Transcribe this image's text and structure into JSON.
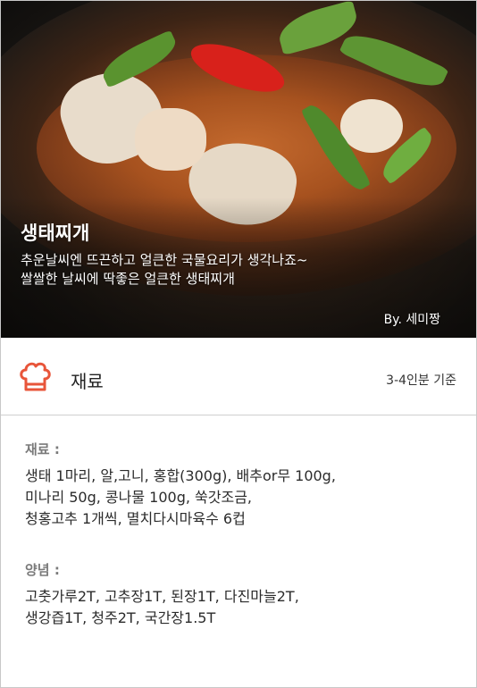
{
  "hero": {
    "title": "생태찌개",
    "subtitle_lines": [
      "추운날씨엔 뜨끈하고 얼큰한 국물요리가 생각나죠~",
      "쌀쌀한 날씨에 딱좋은 얼큰한 생태찌개"
    ],
    "byline": "By. 세미짱"
  },
  "ingredients_header": {
    "icon": "chef-hat-icon",
    "label": "재료",
    "serving": "3-4인분 기준",
    "accent_color": "#e8553a"
  },
  "sections": [
    {
      "title": "재료 :",
      "lines": [
        "생태 1마리, 알,고니, 홍합(300g), 배추or무 100g,",
        "미나리 50g, 콩나물 100g, 쑥갓조금,",
        "청홍고추 1개씩, 멸치다시마육수 6컵"
      ]
    },
    {
      "title": "양념 :",
      "lines": [
        "고춧가루2T, 고추장1T, 된장1T, 다진마늘2T,",
        "생강즙1T, 청주2T, 국간장1.5T"
      ]
    }
  ]
}
